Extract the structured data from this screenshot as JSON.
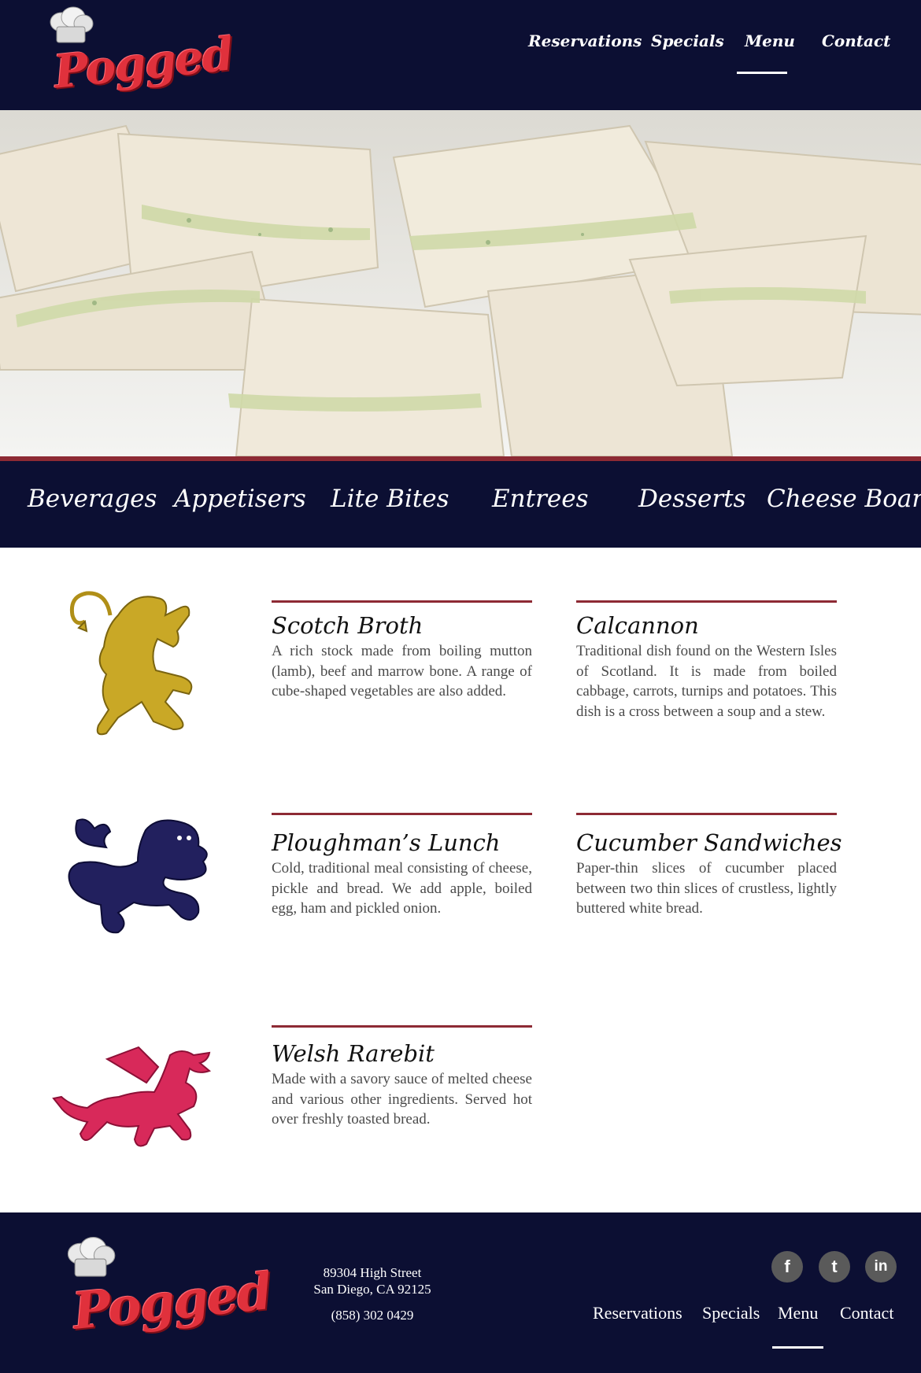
{
  "brand": {
    "logo_text": "Pogged"
  },
  "nav": {
    "items": [
      {
        "label": "Reservations"
      },
      {
        "label": "Specials"
      },
      {
        "label": "Menu",
        "active": true
      },
      {
        "label": "Contact"
      }
    ]
  },
  "categories": [
    {
      "label": "Beverages"
    },
    {
      "label": "Appetisers"
    },
    {
      "label": "Lite Bites"
    },
    {
      "label": "Entrees"
    },
    {
      "label": "Desserts"
    },
    {
      "label": "Cheese Board"
    }
  ],
  "dishes": [
    {
      "title": "Scotch Broth",
      "description": "A rich stock made from boiling mutton (lamb), beef and marrow bone. A range of cube-shaped vegetables are also added."
    },
    {
      "title": "Calcannon",
      "description": "Traditional dish found on the Western Isles of Scotland.  It is made from boiled cabbage, carrots, turnips and potatoes. This dish is a cross between a soup and a stew."
    },
    {
      "title": "Ploughman’s Lunch",
      "description": "Cold, traditional meal consisting of cheese, pickle and bread.  We add apple, boiled egg, ham and pickled onion."
    },
    {
      "title": "Cucumber Sandwiches",
      "description": "Paper-thin slices of cucumber placed between two thin slices of crustless, lightly buttered white bread."
    },
    {
      "title": "Welsh Rarebit",
      "description": "Made with a savory sauce of melted cheese and various other ingredients. Served hot over freshly toasted bread."
    }
  ],
  "emblems": [
    {
      "icon": "gold-lion-rampant-icon",
      "color": "#c9a826"
    },
    {
      "icon": "navy-lion-passant-icon",
      "color": "#22205e"
    },
    {
      "icon": "red-welsh-dragon-icon",
      "color": "#d8295a"
    }
  ],
  "footer": {
    "address_line1": "89304 High Street",
    "address_line2": "San Diego, CA 92125",
    "phone": "(858) 302 0429",
    "social": [
      {
        "icon": "facebook-icon",
        "glyph": "f"
      },
      {
        "icon": "twitter-icon",
        "glyph": "t"
      },
      {
        "icon": "linkedin-icon",
        "glyph": "in"
      }
    ],
    "nav": [
      {
        "label": "Reservations"
      },
      {
        "label": "Specials"
      },
      {
        "label": "Menu",
        "active": true
      },
      {
        "label": "Contact"
      }
    ]
  },
  "colors": {
    "navy": "#0c0f33",
    "accent": "#8d2a34",
    "logo_red": "#e0313c"
  }
}
